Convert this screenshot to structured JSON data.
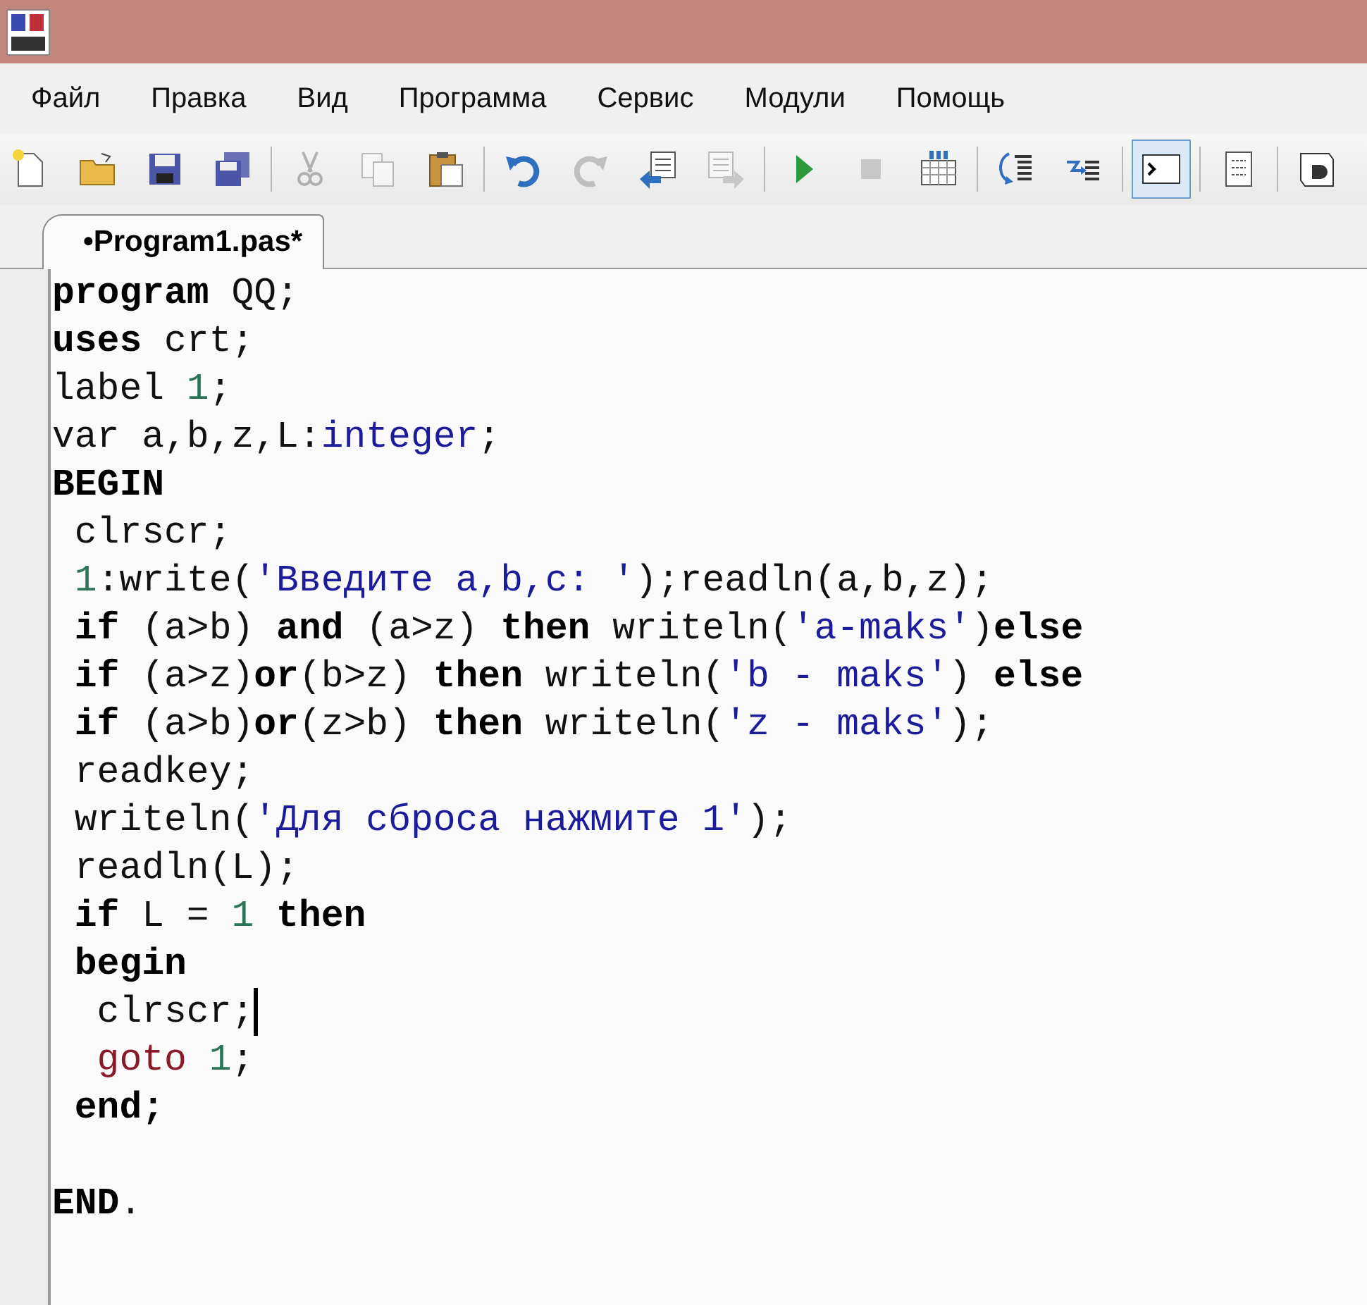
{
  "menu": [
    "Файл",
    "Правка",
    "Вид",
    "Программа",
    "Сервис",
    "Модули",
    "Помощь"
  ],
  "toolbar": [
    {
      "kind": "new",
      "disabled": false,
      "selected": false
    },
    {
      "kind": "open",
      "disabled": false,
      "selected": false
    },
    {
      "kind": "save",
      "disabled": false,
      "selected": false
    },
    {
      "kind": "saveall",
      "disabled": false,
      "selected": false
    },
    {
      "kind": "sep"
    },
    {
      "kind": "cut",
      "disabled": true,
      "selected": false
    },
    {
      "kind": "copy",
      "disabled": true,
      "selected": false
    },
    {
      "kind": "paste",
      "disabled": false,
      "selected": false
    },
    {
      "kind": "sep"
    },
    {
      "kind": "undo",
      "disabled": false,
      "selected": false
    },
    {
      "kind": "redo",
      "disabled": true,
      "selected": false
    },
    {
      "kind": "outdent",
      "disabled": false,
      "selected": false
    },
    {
      "kind": "indent",
      "disabled": true,
      "selected": false
    },
    {
      "kind": "sep"
    },
    {
      "kind": "run",
      "disabled": false,
      "selected": false
    },
    {
      "kind": "stop",
      "disabled": true,
      "selected": false
    },
    {
      "kind": "compile",
      "disabled": false,
      "selected": false
    },
    {
      "kind": "sep"
    },
    {
      "kind": "stepinto",
      "disabled": false,
      "selected": false
    },
    {
      "kind": "stepover",
      "disabled": false,
      "selected": false
    },
    {
      "kind": "sep"
    },
    {
      "kind": "console",
      "disabled": false,
      "selected": true
    },
    {
      "kind": "sep"
    },
    {
      "kind": "doc",
      "disabled": false,
      "selected": false
    },
    {
      "kind": "sep"
    },
    {
      "kind": "book",
      "disabled": false,
      "selected": false
    }
  ],
  "tabs": [
    {
      "label": "•Program1.pas*",
      "selected": true
    }
  ],
  "code": {
    "blocks": [
      {
        "lines": [
          {
            "caret": false,
            "tokens": [
              {
                "kind": "kw",
                "text": "program"
              },
              {
                "kind": "id",
                "text": " QQ;"
              }
            ]
          },
          {
            "caret": false,
            "tokens": [
              {
                "kind": "kw",
                "text": "uses"
              },
              {
                "kind": "id",
                "text": " crt;"
              }
            ]
          },
          {
            "caret": false,
            "tokens": [
              {
                "kind": "id",
                "text": "label "
              },
              {
                "kind": "num",
                "text": "1"
              },
              {
                "kind": "id",
                "text": ";"
              }
            ]
          },
          {
            "caret": false,
            "tokens": [
              {
                "kind": "id",
                "text": "var a,b,z,L:"
              },
              {
                "kind": "type",
                "text": "integer"
              },
              {
                "kind": "id",
                "text": ";"
              }
            ]
          },
          {
            "caret": false,
            "tokens": [
              {
                "kind": "kw",
                "text": "BEGIN"
              }
            ]
          },
          {
            "caret": false,
            "tokens": [
              {
                "kind": "id",
                "text": " clrscr;"
              }
            ]
          },
          {
            "caret": false,
            "tokens": [
              {
                "kind": "num",
                "text": " 1"
              },
              {
                "kind": "id",
                "text": ":write("
              },
              {
                "kind": "str",
                "text": "'Введите a,b,c: '"
              },
              {
                "kind": "id",
                "text": ");readln(a,b,z);"
              }
            ]
          },
          {
            "caret": false,
            "tokens": [
              {
                "kind": "kw",
                "text": " if"
              },
              {
                "kind": "id",
                "text": " (a>b) "
              },
              {
                "kind": "kw",
                "text": "and"
              },
              {
                "kind": "id",
                "text": " (a>z) "
              },
              {
                "kind": "kw",
                "text": "then"
              },
              {
                "kind": "id",
                "text": " writeln("
              },
              {
                "kind": "str",
                "text": "'a-maks'"
              },
              {
                "kind": "id",
                "text": ")"
              },
              {
                "kind": "kw",
                "text": "else"
              }
            ]
          },
          {
            "caret": false,
            "tokens": [
              {
                "kind": "kw",
                "text": " if"
              },
              {
                "kind": "id",
                "text": " (a>z)"
              },
              {
                "kind": "kw",
                "text": "or"
              },
              {
                "kind": "id",
                "text": "(b>z) "
              },
              {
                "kind": "kw",
                "text": "then"
              },
              {
                "kind": "id",
                "text": " writeln("
              },
              {
                "kind": "str",
                "text": "'b - maks'"
              },
              {
                "kind": "id",
                "text": ") "
              },
              {
                "kind": "kw",
                "text": "else"
              }
            ]
          },
          {
            "caret": false,
            "tokens": [
              {
                "kind": "kw",
                "text": " if"
              },
              {
                "kind": "id",
                "text": " (a>b)"
              },
              {
                "kind": "kw",
                "text": "or"
              },
              {
                "kind": "id",
                "text": "(z>b) "
              },
              {
                "kind": "kw",
                "text": "then"
              },
              {
                "kind": "id",
                "text": " writeln("
              },
              {
                "kind": "str",
                "text": "'z - maks'"
              },
              {
                "kind": "id",
                "text": ");"
              }
            ]
          },
          {
            "caret": false,
            "tokens": [
              {
                "kind": "id",
                "text": " readkey;"
              }
            ]
          },
          {
            "caret": false,
            "tokens": [
              {
                "kind": "id",
                "text": " writeln("
              },
              {
                "kind": "str",
                "text": "'Для сброса нажмите 1'"
              },
              {
                "kind": "id",
                "text": ");"
              }
            ]
          },
          {
            "caret": false,
            "tokens": [
              {
                "kind": "id",
                "text": " readln(L);"
              }
            ]
          },
          {
            "caret": false,
            "tokens": [
              {
                "kind": "kw",
                "text": " if"
              },
              {
                "kind": "id",
                "text": " L = "
              },
              {
                "kind": "num",
                "text": "1"
              },
              {
                "kind": "kw",
                "text": " then"
              }
            ]
          },
          {
            "caret": false,
            "tokens": [
              {
                "kind": "kw",
                "text": " begin"
              }
            ]
          },
          {
            "caret": true,
            "tokens": [
              {
                "kind": "id",
                "text": "  clrscr;"
              }
            ]
          },
          {
            "caret": false,
            "tokens": [
              {
                "kind": "goto",
                "text": "  goto"
              },
              {
                "kind": "num",
                "text": " 1"
              },
              {
                "kind": "id",
                "text": ";"
              }
            ]
          },
          {
            "caret": false,
            "tokens": [
              {
                "kind": "kw",
                "text": " end;"
              }
            ]
          }
        ]
      },
      {
        "lines": [
          {
            "caret": false,
            "tokens": [
              {
                "kind": "kw",
                "text": "END"
              },
              {
                "kind": "id",
                "text": "."
              }
            ]
          }
        ]
      }
    ]
  }
}
